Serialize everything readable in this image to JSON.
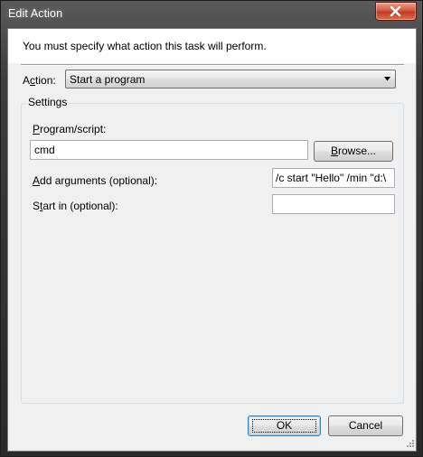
{
  "window": {
    "title": "Edit Action"
  },
  "instruction": "You must specify what action this task will perform.",
  "action": {
    "label_pre": "A",
    "label_ul": "c",
    "label_post": "tion:",
    "selected": "Start a program"
  },
  "settings": {
    "legend": "Settings",
    "program": {
      "label_ul": "P",
      "label_post": "rogram/script:",
      "value": "cmd"
    },
    "browse_pre": "",
    "browse_ul": "B",
    "browse_post": "rowse...",
    "arguments": {
      "label_ul": "A",
      "label_post": "dd arguments (optional):",
      "value": "/c start \"Hello\" /min \"d:\\"
    },
    "start_in": {
      "label_pre": "S",
      "label_ul": "t",
      "label_post": "art in (optional):",
      "value": ""
    }
  },
  "buttons": {
    "ok": "OK",
    "cancel": "Cancel"
  },
  "icons": {
    "close": "close-icon",
    "dropdown": "chevron-down-icon",
    "grip": "size-grip-icon"
  }
}
